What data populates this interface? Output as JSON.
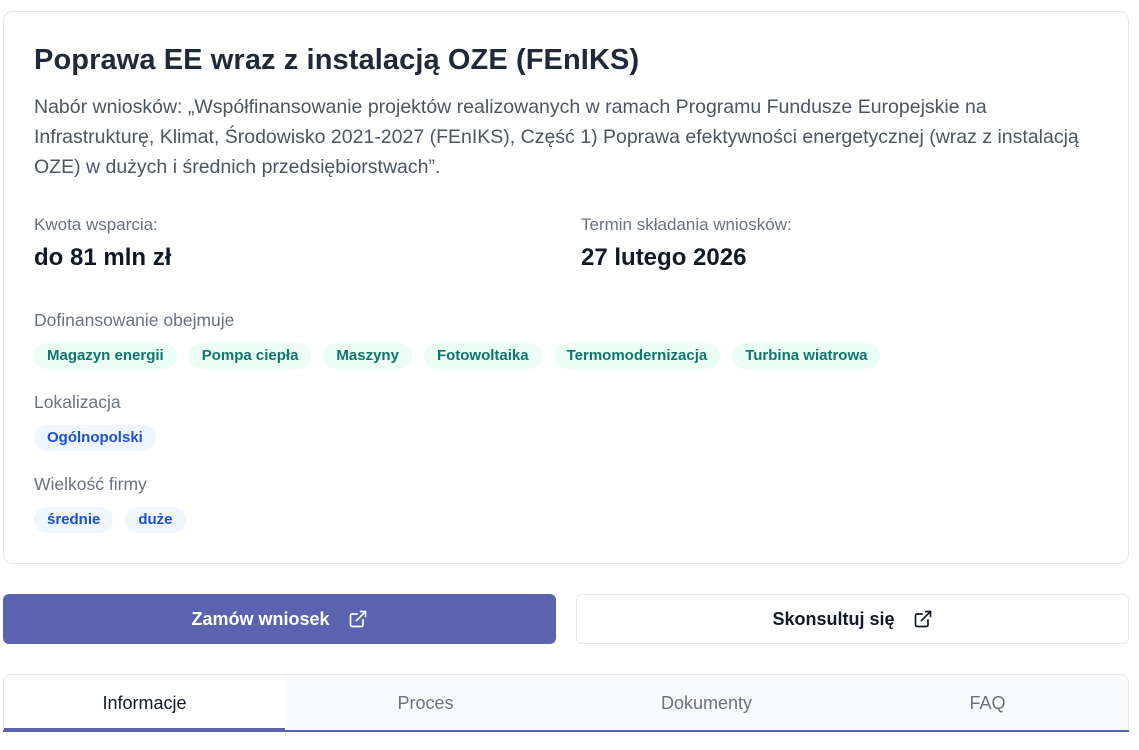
{
  "program": {
    "title": "Poprawa EE wraz z instalacją OZE (FEnIKS)",
    "description": "Nabór wniosków: „Współfinansowanie projektów realizowanych w ramach Programu Fundusze Europejskie na Infrastrukturę, Klimat, Środowisko 2021-2027 (FEnIKS), Część 1) Poprawa efektywności energetycznej (wraz z instalacją OZE) w dużych i średnich przedsiębiorstwach”."
  },
  "support": {
    "label": "Kwota wsparcia:",
    "value": "do 81 mln zł"
  },
  "deadline": {
    "label": "Termin składania wniosków:",
    "value": "27 lutego 2026"
  },
  "funding": {
    "label": "Dofinansowanie obejmuje",
    "tags": [
      "Magazyn energii",
      "Pompa ciepła",
      "Maszyny",
      "Fotowoltaika",
      "Termomodernizacja",
      "Turbina wiatrowa"
    ]
  },
  "location": {
    "label": "Lokalizacja",
    "tags": [
      "Ogólnopolski"
    ]
  },
  "company_size": {
    "label": "Wielkość firmy",
    "tags": [
      "średnie",
      "duże"
    ]
  },
  "actions": {
    "primary_label": "Zamów wniosek",
    "secondary_label": "Skonsultuj się",
    "icon": "external-link-icon"
  },
  "tabs": [
    {
      "label": "Informacje",
      "active": true
    },
    {
      "label": "Proces",
      "active": false
    },
    {
      "label": "Dokumenty",
      "active": false
    },
    {
      "label": "FAQ",
      "active": false
    }
  ],
  "colors": {
    "accent": "#5b63b0",
    "green_chip": "#0f766e",
    "blue_chip": "#1d4ed8"
  }
}
